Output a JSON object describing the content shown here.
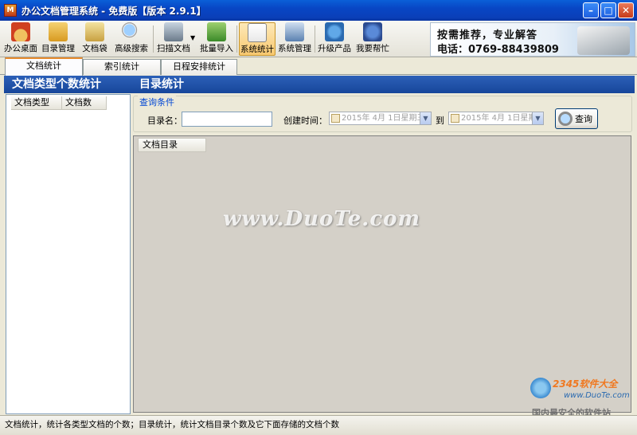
{
  "window": {
    "title": "办公文档管理系统  -  免费版【版本 2.9.1】",
    "app_icon_text": "M"
  },
  "toolbar": {
    "items": [
      {
        "label": "办公桌面",
        "icon": "home-icon"
      },
      {
        "label": "目录管理",
        "icon": "folder-icon"
      },
      {
        "label": "文档袋",
        "icon": "document-bag-icon"
      },
      {
        "label": "高级搜索",
        "icon": "magnifier-icon"
      },
      {
        "label": "扫描文档",
        "icon": "scanner-icon"
      },
      {
        "label": "批量导入",
        "icon": "import-icon"
      },
      {
        "label": "系统统计",
        "icon": "chart-icon"
      },
      {
        "label": "系统管理",
        "icon": "system-admin-icon"
      },
      {
        "label": "升级产品",
        "icon": "upgrade-icon"
      },
      {
        "label": "我要帮忙",
        "icon": "help-icon"
      }
    ]
  },
  "promo": {
    "line1": "按需推荐，专业解答",
    "line2": "电话：0769-88439809"
  },
  "tabs": [
    {
      "label": "文档统计",
      "active": true
    },
    {
      "label": "索引统计",
      "active": false
    },
    {
      "label": "日程安排统计",
      "active": false
    }
  ],
  "left_panel": {
    "title": "文档类型个数统计",
    "columns": [
      "文档类型",
      "文档数"
    ]
  },
  "right_panel": {
    "title": "目录统计",
    "query": {
      "group_title": "查询条件",
      "dir_name_label": "目录名：",
      "dir_name_value": "",
      "created_label": "创建时间：",
      "date_from": "2015年  4月  1日星期三",
      "to_label": "到",
      "date_to": "2015年  4月  1日星期",
      "search_button": "查询"
    },
    "grid_columns": [
      "文档目录"
    ]
  },
  "watermark": "www.DuoTe.com",
  "status_bar": "文档统计，统计各类型文档的个数；目录统计，统计文档目录个数及它下面存储的文档个数",
  "corner_logo": {
    "brand": "2345软件大全",
    "site": "www.DuoTe.com",
    "slogan": "国内最安全的软件站"
  }
}
